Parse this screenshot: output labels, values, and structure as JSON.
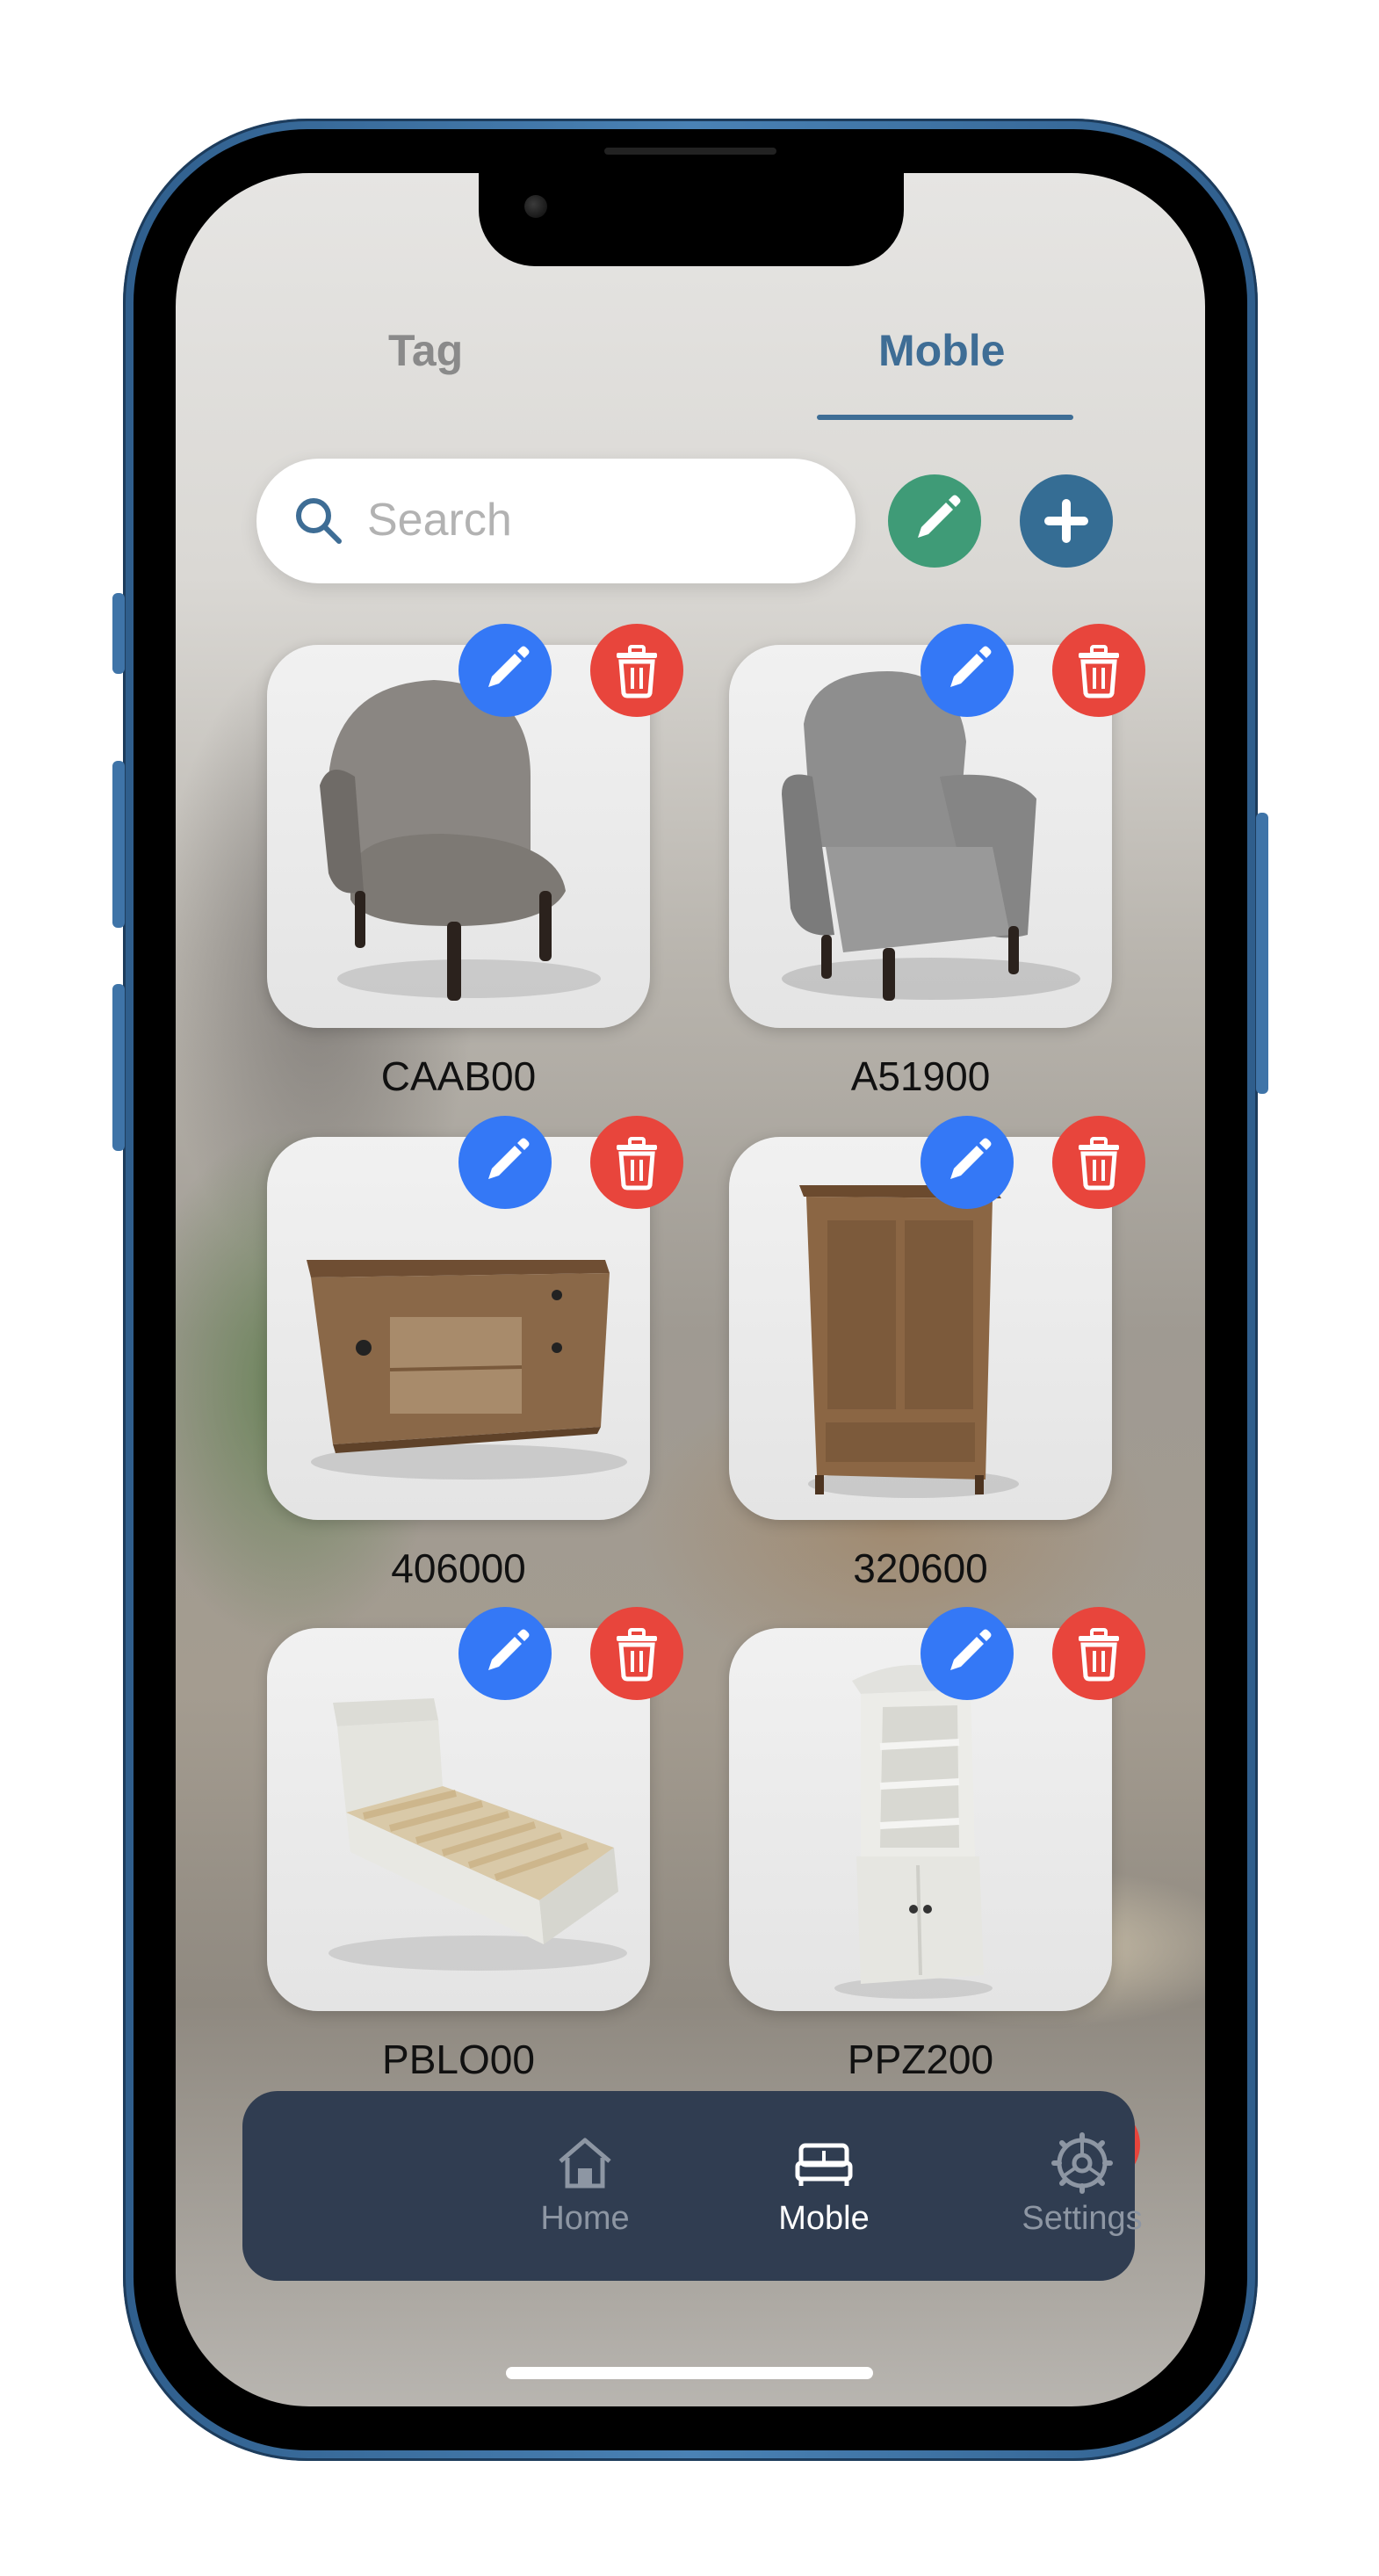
{
  "tabs": [
    {
      "label": "Tag",
      "active": false
    },
    {
      "label": "Moble",
      "active": true
    }
  ],
  "search": {
    "placeholder": "Search"
  },
  "actions": {
    "edit_all_icon": "pencil-icon",
    "add_icon": "plus-icon"
  },
  "items": [
    {
      "code": "CAAB00",
      "image": "tufted-chair"
    },
    {
      "code": "A51900",
      "image": "armchair"
    },
    {
      "code": "406000",
      "image": "tv-cabinet"
    },
    {
      "code": "320600",
      "image": "wardrobe"
    },
    {
      "code": "PBLO00",
      "image": "single-bed"
    },
    {
      "code": "PPZ200",
      "image": "corner-cabinet"
    }
  ],
  "nav": [
    {
      "label": "Home",
      "icon": "house-icon",
      "active": false
    },
    {
      "label": "Moble",
      "icon": "bed-icon",
      "active": true
    },
    {
      "label": "Settings",
      "icon": "gear-icon",
      "active": false
    }
  ],
  "colors": {
    "accent": "#3e6d95",
    "edit_blue": "#3478f6",
    "delete_red": "#e8453c",
    "edit_green": "#3f9b77",
    "nav_bg": "#303d51"
  }
}
